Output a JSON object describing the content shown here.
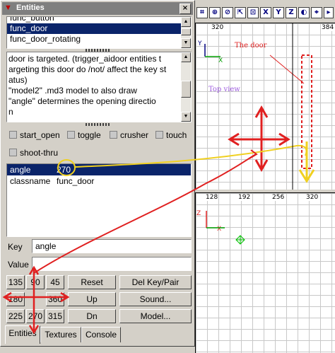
{
  "window": {
    "title": "Entities",
    "close_glyph": "×"
  },
  "classes": {
    "items": [
      "func_button",
      "func_door",
      "func_door_rotating"
    ],
    "selected": 1
  },
  "description": [
    "door is targeted.  (trigger_aidoor entities t",
    "argeting this door do /not/ affect the key st",
    "atus)",
    "\"model2\"    .md3 model to also draw",
    "\"angle\"     determines the opening directio",
    "n"
  ],
  "flags": [
    "start_open",
    "toggle",
    "crusher",
    "touch",
    "shoot-thru"
  ],
  "keyvalues": [
    {
      "key": "angle",
      "value": "270",
      "selected": true
    },
    {
      "key": "classname",
      "value": "func_door",
      "selected": false
    }
  ],
  "key_label": "Key",
  "key_value": "angle",
  "value_label": "Value",
  "value_value": "",
  "angle_buttons": [
    "135",
    "90",
    "45",
    "180",
    "360",
    "225",
    "270",
    "315"
  ],
  "action_buttons": {
    "reset": "Reset",
    "up": "Up",
    "dn": "Dn",
    "del_key_pair": "Del Key/Pair",
    "sound": "Sound...",
    "model": "Model..."
  },
  "tabs": [
    "Entities",
    "Textures",
    "Console"
  ],
  "active_tab": 0,
  "toolbar_letters": [
    "X",
    "Y",
    "Z"
  ],
  "top_view": {
    "coords": [
      "320",
      "384"
    ],
    "axis_y": "Y",
    "axis_x": "X",
    "annotation_door": "The door",
    "annotation_view": "Top view"
  },
  "front_view": {
    "coords": [
      "128",
      "192",
      "256",
      "320"
    ],
    "axis_z": "Z",
    "axis_x": "X"
  },
  "colors": {
    "selection": "#0a246a",
    "annotation_red": "#e02020",
    "annotation_yellow": "#f0d020",
    "annotation_purple": "#a060e0",
    "axis_green": "#00a000"
  }
}
